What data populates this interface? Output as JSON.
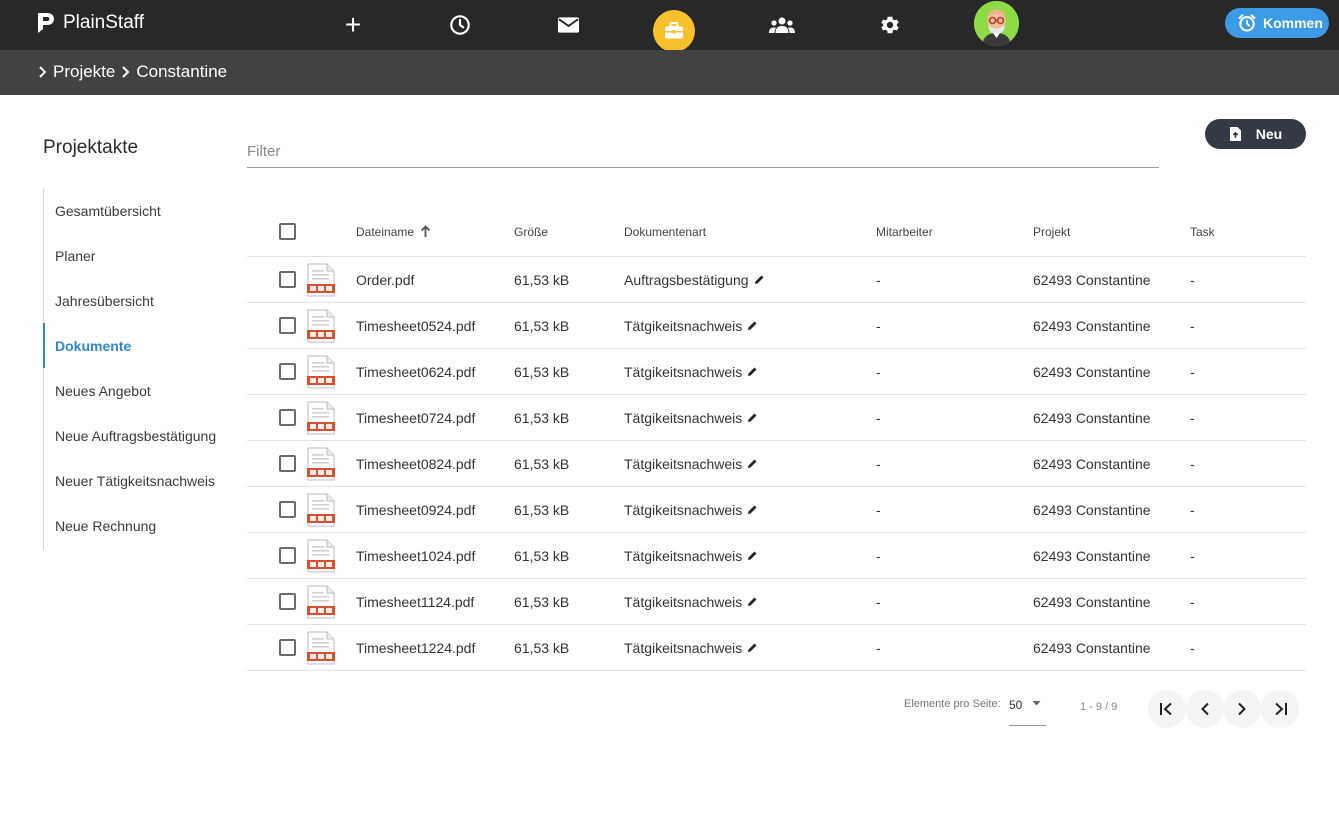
{
  "app": {
    "name": "PlainStaff"
  },
  "header": {
    "kommen_label": "Kommen",
    "nav": [
      "plus-icon",
      "clock-icon",
      "mail-icon",
      "briefcase-icon",
      "group-icon",
      "gear-icon",
      "avatar"
    ]
  },
  "breadcrumb": {
    "items": [
      "Projekte",
      "Constantine"
    ]
  },
  "sidebar": {
    "title": "Projektakte",
    "items": [
      {
        "label": "Gesamtübersicht"
      },
      {
        "label": "Planer"
      },
      {
        "label": "Jahresübersicht"
      },
      {
        "label": "Dokumente",
        "active": true
      },
      {
        "label": "Neues Angebot"
      },
      {
        "label": "Neue Auftragsbestätigung"
      },
      {
        "label": "Neuer Tätigkeitsnachweis"
      },
      {
        "label": "Neue Rechnung"
      }
    ]
  },
  "filter": {
    "placeholder": "Filter"
  },
  "toolbar": {
    "new_label": "Neu"
  },
  "table": {
    "columns": [
      "Dateiname",
      "Größe",
      "Dokumentenart",
      "Mitarbeiter",
      "Projekt",
      "Task"
    ],
    "rows": [
      {
        "name": "Order.pdf",
        "size": "61,53 kB",
        "type": "Auftragsbestätigung",
        "employee": "-",
        "project": "62493 Constantine",
        "task": "-"
      },
      {
        "name": "Timesheet0524.pdf",
        "size": "61,53 kB",
        "type": "Tätgikeitsnachweis",
        "employee": "-",
        "project": "62493 Constantine",
        "task": "-"
      },
      {
        "name": "Timesheet0624.pdf",
        "size": "61,53 kB",
        "type": "Tätgikeitsnachweis",
        "employee": "-",
        "project": "62493 Constantine",
        "task": "-"
      },
      {
        "name": "Timesheet0724.pdf",
        "size": "61,53 kB",
        "type": "Tätgikeitsnachweis",
        "employee": "-",
        "project": "62493 Constantine",
        "task": "-"
      },
      {
        "name": "Timesheet0824.pdf",
        "size": "61,53 kB",
        "type": "Tätgikeitsnachweis",
        "employee": "-",
        "project": "62493 Constantine",
        "task": "-"
      },
      {
        "name": "Timesheet0924.pdf",
        "size": "61,53 kB",
        "type": "Tätgikeitsnachweis",
        "employee": "-",
        "project": "62493 Constantine",
        "task": "-"
      },
      {
        "name": "Timesheet1024.pdf",
        "size": "61,53 kB",
        "type": "Tätgikeitsnachweis",
        "employee": "-",
        "project": "62493 Constantine",
        "task": "-"
      },
      {
        "name": "Timesheet1124.pdf",
        "size": "61,53 kB",
        "type": "Tätgikeitsnachweis",
        "employee": "-",
        "project": "62493 Constantine",
        "task": "-"
      },
      {
        "name": "Timesheet1224.pdf",
        "size": "61,53 kB",
        "type": "Tätgikeitsnachweis",
        "employee": "-",
        "project": "62493 Constantine",
        "task": "-"
      }
    ]
  },
  "pagination": {
    "per_page_label": "Elemente pro Seite:",
    "per_page_value": "50",
    "range": "1 - 9 / 9"
  },
  "colors": {
    "topbar": "#282828",
    "crumbbar": "#424242",
    "accent_yellow": "#f6c12b",
    "accent_blue": "#3c9ae6",
    "active_link": "#2f86d1",
    "pdf_red": "#d9502f"
  }
}
